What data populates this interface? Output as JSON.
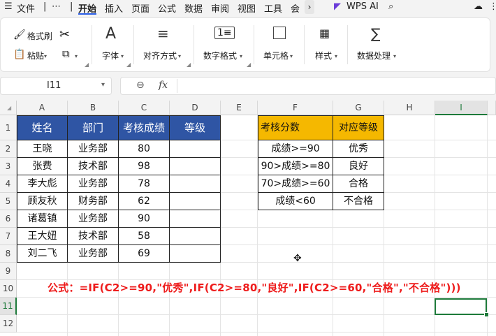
{
  "menu": {
    "file": "文件",
    "more": "⋯",
    "tabs": [
      "开始",
      "插入",
      "页面",
      "公式",
      "数据",
      "审阅",
      "视图",
      "工具",
      "会"
    ],
    "active_tab": "开始",
    "wps_ai": "WPS AI"
  },
  "ribbon": {
    "format_painter": "格式刷",
    "paste": "粘贴",
    "font": "字体",
    "align": "对齐方式",
    "number_format": "数字格式",
    "cell": "单元格",
    "style": "样式",
    "data_process": "数据处理"
  },
  "formula_bar": {
    "name_box": "I11",
    "fx": "fx",
    "content": ""
  },
  "columns": [
    "A",
    "B",
    "C",
    "D",
    "E",
    "F",
    "G",
    "H",
    "I"
  ],
  "rows": [
    "1",
    "2",
    "3",
    "4",
    "5",
    "6",
    "7",
    "8",
    "9",
    "10",
    "11",
    "12"
  ],
  "table1": {
    "headers": [
      "姓名",
      "部门",
      "考核成绩",
      "等级"
    ],
    "rows": [
      [
        "王晓",
        "业务部",
        "80",
        ""
      ],
      [
        "张费",
        "技术部",
        "98",
        ""
      ],
      [
        "李大彪",
        "业务部",
        "78",
        ""
      ],
      [
        "顾友秋",
        "财务部",
        "62",
        ""
      ],
      [
        "诸葛镇",
        "业务部",
        "90",
        ""
      ],
      [
        "王大妞",
        "技术部",
        "58",
        ""
      ],
      [
        "刘二飞",
        "业务部",
        "69",
        ""
      ]
    ]
  },
  "table2": {
    "headers": [
      "考核分数",
      "对应等级"
    ],
    "rows": [
      [
        "成绩>=90",
        "优秀"
      ],
      [
        "90>成绩>=80",
        "良好"
      ],
      [
        "70>成绩>=60",
        "合格"
      ],
      [
        "成绩<60",
        "不合格"
      ]
    ]
  },
  "formula_note": "公式：=IF(C2>=90,\"优秀\",IF(C2>=80,\"良好\",IF(C2>=60,\"合格\",\"不合格\")))",
  "colors": {
    "header_blue": "#2f55a4",
    "header_gold": "#f5b800",
    "formula_red": "#ee1c1c",
    "selection_green": "#1d7a3a"
  }
}
